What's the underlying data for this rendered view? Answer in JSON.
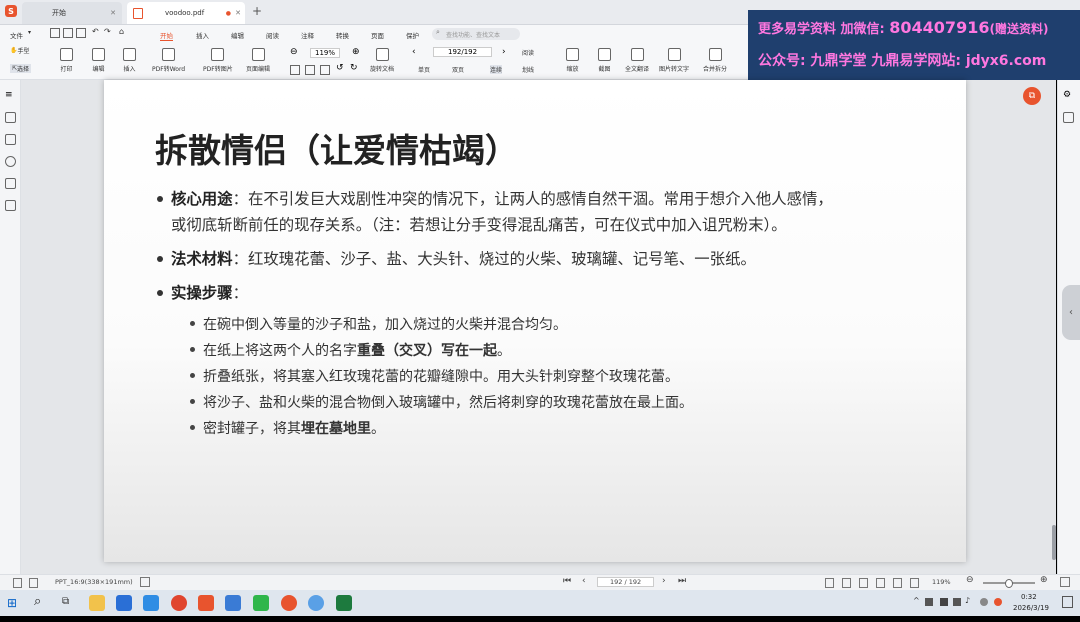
{
  "tabs": [
    {
      "label": "开始"
    },
    {
      "label": "voodoo.pdf"
    }
  ],
  "watermark": {
    "line1_prefix": "更多易学资料 加微信: ",
    "line1_number": "804407916",
    "line1_suffix": "(赠送资料)",
    "line2": "公众号: 九鼎学堂 九鼎易学网站: jdyx6.com"
  },
  "menu": {
    "file": "文件",
    "items": [
      "开始",
      "插入",
      "编辑",
      "阅读",
      "注释",
      "转换",
      "页面",
      "保护"
    ],
    "search_placeholder": "查找功能、查找文本"
  },
  "ribbon": {
    "hand": "手型",
    "select": "选择",
    "print": "打印",
    "edit": "编辑",
    "insert": "插入",
    "pdf_to_word": "PDF转Word",
    "pdf_to_image": "PDF转图片",
    "page_edit": "页面编辑",
    "zoom": "119%",
    "page": "192/192",
    "rotate_doc": "旋转文档",
    "single": "单页",
    "double": "双页",
    "continuous": "连续",
    "read": "阅读",
    "underline": "划线",
    "zoom_mode": "缩放",
    "screenshot": "截图",
    "full_translate": "全文翻译",
    "image_to_text": "图片转文字",
    "merge_split": "合并拆分"
  },
  "content": {
    "title": "拆散情侣（让爱情枯竭）",
    "b1_label": "核心用途",
    "b1_line1": "：在不引发巨大戏剧性冲突的情况下，让两人的感情自然干涸。常用于想介入他人感情，",
    "b1_line2": "或彻底斩断前任的现存关系。（注：若想让分手变得混乱痛苦，可在仪式中加入诅咒粉末）。",
    "b2_label": "法术材料",
    "b2_text": "：红玫瑰花蕾、沙子、盐、大头针、烧过的火柴、玻璃罐、记号笔、一张纸。",
    "b3_label": "实操步骤",
    "b3_text": "：",
    "steps": [
      {
        "pre": "在碗中倒入等量的沙子和盐，加入烧过的火柴并混合均匀。",
        "bold": "",
        "post": ""
      },
      {
        "pre": "在纸上将这两个人的名字",
        "bold": "重叠（交叉）写在一起",
        "post": "。"
      },
      {
        "pre": "折叠纸张，将其塞入红玫瑰花蕾的花瓣缝隙中。用大头针刺穿整个玫瑰花蕾。",
        "bold": "",
        "post": ""
      },
      {
        "pre": "将沙子、盐和火柴的混合物倒入玻璃罐中，然后将刺穿的玫瑰花蕾放在最上面。",
        "bold": "",
        "post": ""
      },
      {
        "pre": "密封罐子，将其",
        "bold": "埋在墓地里",
        "post": "。"
      }
    ]
  },
  "status": {
    "page_size": "PPT_16:9(338×191mm)",
    "page": "192 / 192",
    "zoom": "119%"
  },
  "taskbar": {
    "time": "0:32",
    "date": "2026/3/19"
  }
}
